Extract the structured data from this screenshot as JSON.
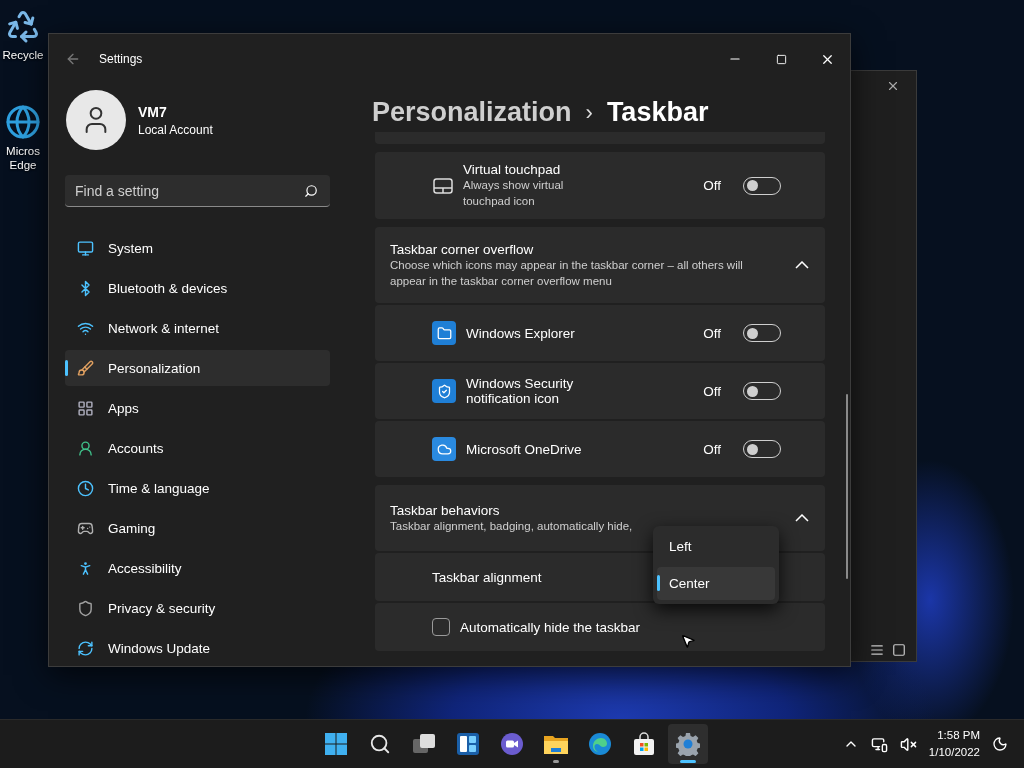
{
  "desktop_icons": [
    {
      "label": "Recycle"
    },
    {
      "label": "Micros Edge"
    }
  ],
  "settings": {
    "title": "Settings",
    "user": {
      "name": "VM7",
      "account": "Local Account"
    },
    "search": {
      "placeholder": "Find a setting"
    },
    "nav": [
      {
        "label": "System",
        "selected": false
      },
      {
        "label": "Bluetooth & devices",
        "selected": false
      },
      {
        "label": "Network & internet",
        "selected": false
      },
      {
        "label": "Personalization",
        "selected": true
      },
      {
        "label": "Apps",
        "selected": false
      },
      {
        "label": "Accounts",
        "selected": false
      },
      {
        "label": "Time & language",
        "selected": false
      },
      {
        "label": "Gaming",
        "selected": false
      },
      {
        "label": "Accessibility",
        "selected": false
      },
      {
        "label": "Privacy & security",
        "selected": false
      },
      {
        "label": "Windows Update",
        "selected": false
      }
    ],
    "breadcrumb": {
      "parent": "Personalization",
      "separator": "›",
      "current": "Taskbar"
    },
    "cards": [
      {
        "kind": "toggle",
        "title": "Virtual touchpad",
        "description": "Always show virtual touchpad icon",
        "state": "Off",
        "on": false
      },
      {
        "kind": "expander",
        "title": "Taskbar corner overflow",
        "description": "Choose which icons may appear in the taskbar corner – all others will appear in the taskbar corner overflow menu",
        "expanded": true,
        "rows": [
          {
            "kind": "app",
            "title": "Windows Explorer",
            "state": "Off",
            "on": false
          },
          {
            "kind": "app",
            "title": "Windows Security notification icon",
            "state": "Off",
            "on": false
          },
          {
            "kind": "app",
            "title": "Microsoft OneDrive",
            "state": "Off",
            "on": false
          }
        ]
      },
      {
        "kind": "expander",
        "title": "Taskbar behaviors",
        "description": "Taskbar alignment, badging, automatically hide,",
        "expanded": true,
        "rows": [
          {
            "kind": "dropdown",
            "title": "Taskbar alignment"
          },
          {
            "kind": "checkbox",
            "title": "Automatically hide the taskbar",
            "checked": false
          }
        ]
      }
    ],
    "dropdown_menu": [
      {
        "label": "Left",
        "selected": false
      },
      {
        "label": "Center",
        "selected": true
      }
    ]
  },
  "taskbar": {
    "apps": [
      {
        "running": false,
        "active": false
      },
      {
        "running": false,
        "active": false
      },
      {
        "running": false,
        "active": false
      },
      {
        "running": false,
        "active": false
      },
      {
        "running": false,
        "active": false
      },
      {
        "running": true,
        "active": false
      },
      {
        "running": false,
        "active": false
      },
      {
        "running": false,
        "active": false
      },
      {
        "running": true,
        "active": true
      }
    ],
    "time": "1:58 PM",
    "date": "1/10/2022"
  }
}
